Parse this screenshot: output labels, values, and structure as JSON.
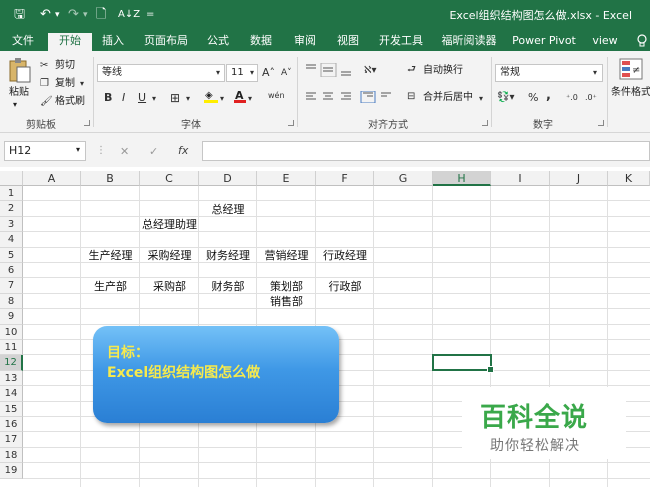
{
  "window": {
    "title": "Excel组织结构图怎么做.xlsx  -  Excel"
  },
  "quick_access": {
    "save": "🖫",
    "undo": "↶",
    "undo_menu": "▾",
    "redo": "↷",
    "redo_menu": "▾",
    "preview": "🗋",
    "sort": "A↓Z",
    "customize": "="
  },
  "tabs": [
    "文件",
    "开始",
    "插入",
    "页面布局",
    "公式",
    "数据",
    "审阅",
    "视图",
    "开发工具",
    "福昕阅读器",
    "Power Pivot",
    "view"
  ],
  "tell_me_icon": "lightbulb-icon",
  "ribbon": {
    "clipboard": {
      "paste": "粘贴",
      "cut": "剪切",
      "copy": "复制",
      "format_painter": "格式刷",
      "label": "剪贴板"
    },
    "font": {
      "name": "等线",
      "size": "11",
      "grow": "A˄",
      "shrink": "A˅",
      "bold": "B",
      "italic": "I",
      "underline": "U",
      "wen": "wén",
      "label": "字体"
    },
    "alignment": {
      "wrap": "自动换行",
      "merge": "合并后居中",
      "label": "对齐方式"
    },
    "number": {
      "format": "常规",
      "percent": "%",
      "comma": ",",
      "label": "数字"
    },
    "styles": {
      "conditional": "条件格式"
    }
  },
  "formula_bar": {
    "name_box": "H12",
    "cancel": "✕",
    "enter": "✓",
    "fx": "fx",
    "value": ""
  },
  "columns": [
    "A",
    "B",
    "C",
    "D",
    "E",
    "F",
    "G",
    "H",
    "I",
    "J",
    "K"
  ],
  "rows": [
    "1",
    "2",
    "3",
    "4",
    "5",
    "6",
    "7",
    "8",
    "9",
    "10",
    "11",
    "12",
    "13",
    "14",
    "15",
    "16",
    "17",
    "18",
    "19"
  ],
  "cells": {
    "D2": "总经理",
    "C3": "总经理助理",
    "B5": "生产经理",
    "C5": "采购经理",
    "D5": "财务经理",
    "E5": "营销经理",
    "F5": "行政经理",
    "B7": "生产部",
    "C7": "采购部",
    "D7": "财务部",
    "E7": "策划部",
    "F7": "行政部",
    "E8": "销售部"
  },
  "selected_cell": "H12",
  "callout": {
    "line1": "目标：",
    "line2": "Excel组织结构图怎么做"
  },
  "watermark": {
    "title": "百科全说",
    "subtitle": "助你轻松解决"
  },
  "colors": {
    "excel_green": "#217346",
    "callout_blue": "#3f98e6",
    "callout_text": "#f7ea4c",
    "watermark_green": "#3aa84a"
  }
}
